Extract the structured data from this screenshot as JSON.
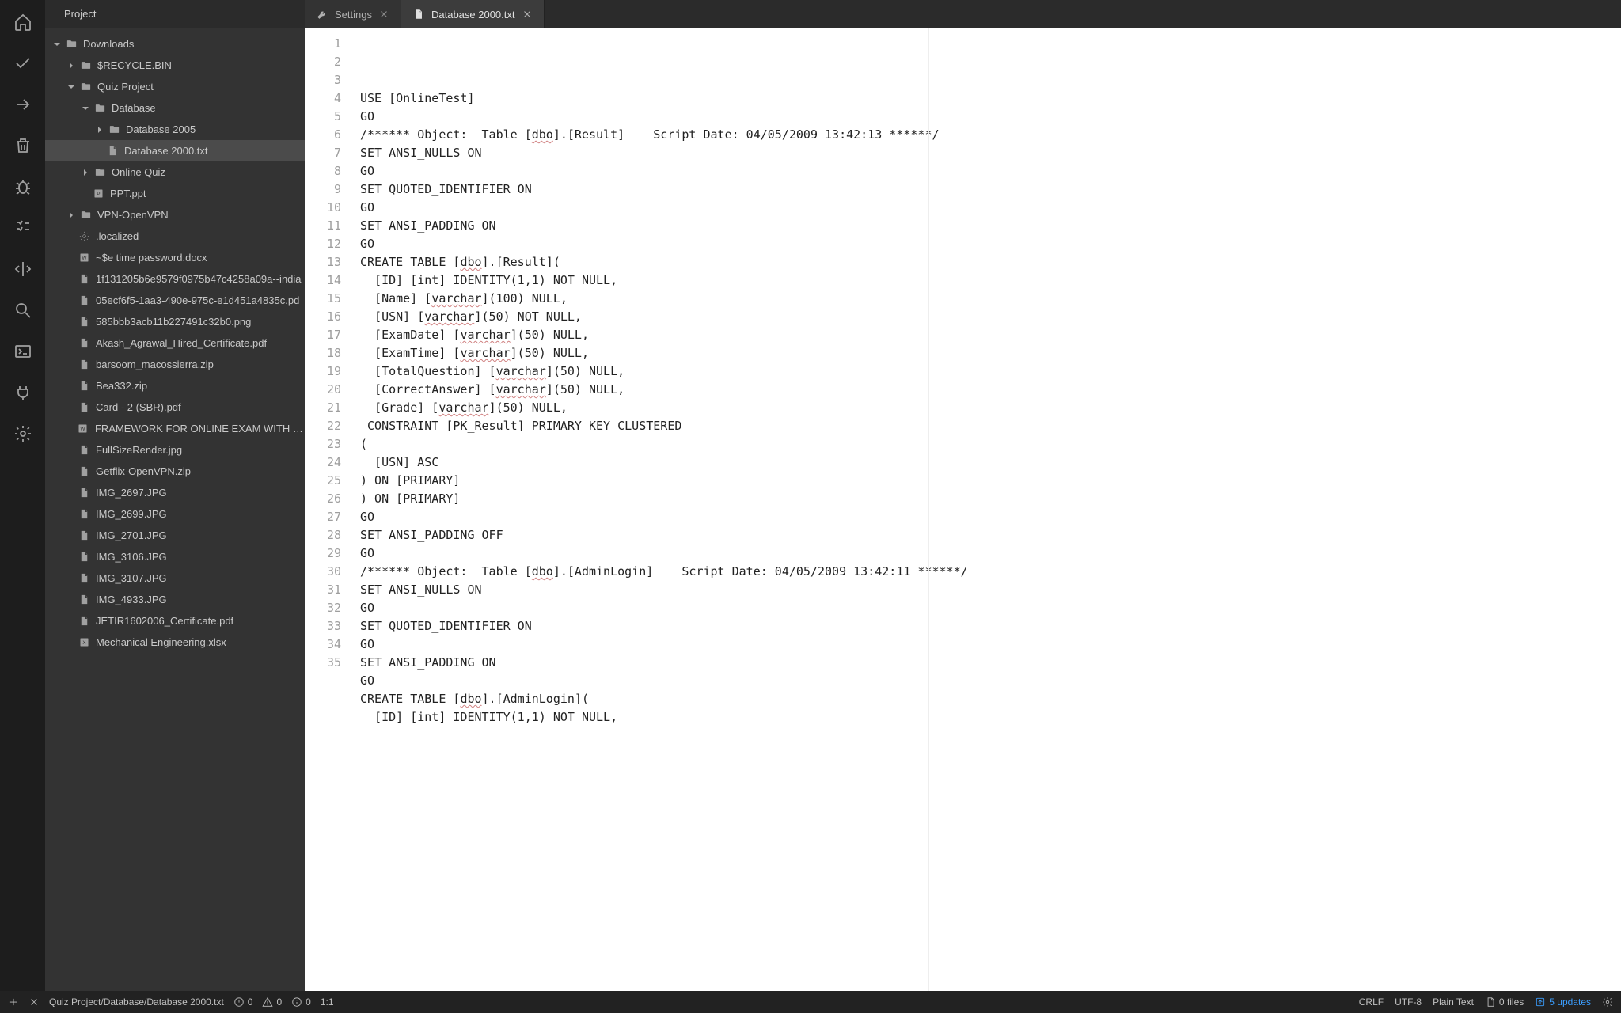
{
  "sidebar": {
    "title": "Project"
  },
  "tree": [
    {
      "depth": 0,
      "arrow": "down",
      "icon": "folder",
      "label": "Downloads"
    },
    {
      "depth": 1,
      "arrow": "right",
      "icon": "folder",
      "label": "$RECYCLE.BIN"
    },
    {
      "depth": 1,
      "arrow": "down",
      "icon": "folder",
      "label": "Quiz Project"
    },
    {
      "depth": 2,
      "arrow": "down",
      "icon": "folder",
      "label": "Database"
    },
    {
      "depth": 3,
      "arrow": "right",
      "icon": "folder",
      "label": "Database 2005"
    },
    {
      "depth": 3,
      "arrow": "none",
      "icon": "file",
      "label": "Database 2000.txt",
      "selected": true
    },
    {
      "depth": 2,
      "arrow": "right",
      "icon": "folder",
      "label": "Online Quiz"
    },
    {
      "depth": 2,
      "arrow": "none",
      "icon": "ppt",
      "label": "PPT.ppt"
    },
    {
      "depth": 1,
      "arrow": "right",
      "icon": "folder",
      "label": "VPN-OpenVPN"
    },
    {
      "depth": 1,
      "arrow": "none",
      "icon": "gear",
      "label": ".localized"
    },
    {
      "depth": 1,
      "arrow": "none",
      "icon": "word",
      "label": "~$e time password.docx"
    },
    {
      "depth": 1,
      "arrow": "none",
      "icon": "pdf",
      "label": "1f131205b6e9579f0975b47c4258a09a--india"
    },
    {
      "depth": 1,
      "arrow": "none",
      "icon": "pdf",
      "label": "05ecf6f5-1aa3-490e-975c-e1d451a4835c.pd"
    },
    {
      "depth": 1,
      "arrow": "none",
      "icon": "pdf",
      "label": "585bbb3acb11b227491c32b0.png"
    },
    {
      "depth": 1,
      "arrow": "none",
      "icon": "pdf",
      "label": "Akash_Agrawal_Hired_Certificate.pdf"
    },
    {
      "depth": 1,
      "arrow": "none",
      "icon": "pdf",
      "label": "barsoom_macossierra.zip"
    },
    {
      "depth": 1,
      "arrow": "none",
      "icon": "pdf",
      "label": "Bea332.zip"
    },
    {
      "depth": 1,
      "arrow": "none",
      "icon": "pdf",
      "label": "Card - 2 (SBR).pdf"
    },
    {
      "depth": 1,
      "arrow": "none",
      "icon": "word",
      "label": "FRAMEWORK FOR ONLINE EXAM WITH GRAP"
    },
    {
      "depth": 1,
      "arrow": "none",
      "icon": "pdf",
      "label": "FullSizeRender.jpg"
    },
    {
      "depth": 1,
      "arrow": "none",
      "icon": "pdf",
      "label": "Getflix-OpenVPN.zip"
    },
    {
      "depth": 1,
      "arrow": "none",
      "icon": "pdf",
      "label": "IMG_2697.JPG"
    },
    {
      "depth": 1,
      "arrow": "none",
      "icon": "pdf",
      "label": "IMG_2699.JPG"
    },
    {
      "depth": 1,
      "arrow": "none",
      "icon": "pdf",
      "label": "IMG_2701.JPG"
    },
    {
      "depth": 1,
      "arrow": "none",
      "icon": "pdf",
      "label": "IMG_3106.JPG"
    },
    {
      "depth": 1,
      "arrow": "none",
      "icon": "pdf",
      "label": "IMG_3107.JPG"
    },
    {
      "depth": 1,
      "arrow": "none",
      "icon": "pdf",
      "label": "IMG_4933.JPG"
    },
    {
      "depth": 1,
      "arrow": "none",
      "icon": "pdf",
      "label": "JETIR1602006_Certificate.pdf"
    },
    {
      "depth": 1,
      "arrow": "none",
      "icon": "excel",
      "label": "Mechanical Engineering.xlsx"
    }
  ],
  "tabs": [
    {
      "icon": "wrench",
      "label": "Settings",
      "active": false
    },
    {
      "icon": "file",
      "label": "Database 2000.txt",
      "active": true
    }
  ],
  "code": {
    "lines": [
      {
        "n": 1,
        "segs": [
          {
            "t": "USE [OnlineTest]"
          }
        ]
      },
      {
        "n": 2,
        "segs": [
          {
            "t": "GO"
          }
        ]
      },
      {
        "n": 3,
        "segs": [
          {
            "t": "/****** Object:  Table ["
          },
          {
            "t": "dbo",
            "w": true
          },
          {
            "t": "].[Result]    Script Date: 04/05/2009 13:42:13 ******/"
          }
        ]
      },
      {
        "n": 4,
        "segs": [
          {
            "t": "SET ANSI_NULLS ON"
          }
        ]
      },
      {
        "n": 5,
        "segs": [
          {
            "t": "GO"
          }
        ]
      },
      {
        "n": 6,
        "segs": [
          {
            "t": "SET QUOTED_IDENTIFIER ON"
          }
        ]
      },
      {
        "n": 7,
        "segs": [
          {
            "t": "GO"
          }
        ]
      },
      {
        "n": 8,
        "segs": [
          {
            "t": "SET ANSI_PADDING ON"
          }
        ]
      },
      {
        "n": 9,
        "segs": [
          {
            "t": "GO"
          }
        ]
      },
      {
        "n": 10,
        "segs": [
          {
            "t": "CREATE TABLE ["
          },
          {
            "t": "dbo",
            "w": true
          },
          {
            "t": "].[Result]("
          }
        ]
      },
      {
        "n": 11,
        "segs": [
          {
            "t": "  [ID] [int] IDENTITY(1,1) NOT NULL,"
          }
        ]
      },
      {
        "n": 12,
        "segs": [
          {
            "t": "  [Name] ["
          },
          {
            "t": "varchar",
            "w": true
          },
          {
            "t": "](100) NULL,"
          }
        ]
      },
      {
        "n": 13,
        "segs": [
          {
            "t": "  [USN] ["
          },
          {
            "t": "varchar",
            "w": true
          },
          {
            "t": "](50) NOT NULL,"
          }
        ]
      },
      {
        "n": 14,
        "segs": [
          {
            "t": "  [ExamDate] ["
          },
          {
            "t": "varchar",
            "w": true
          },
          {
            "t": "](50) NULL,"
          }
        ]
      },
      {
        "n": 15,
        "segs": [
          {
            "t": "  [ExamTime] ["
          },
          {
            "t": "varchar",
            "w": true
          },
          {
            "t": "](50) NULL,"
          }
        ]
      },
      {
        "n": 16,
        "segs": [
          {
            "t": "  [TotalQuestion] ["
          },
          {
            "t": "varchar",
            "w": true
          },
          {
            "t": "](50) NULL,"
          }
        ]
      },
      {
        "n": 17,
        "segs": [
          {
            "t": "  [CorrectAnswer] ["
          },
          {
            "t": "varchar",
            "w": true
          },
          {
            "t": "](50) NULL,"
          }
        ]
      },
      {
        "n": 18,
        "segs": [
          {
            "t": "  [Grade] ["
          },
          {
            "t": "varchar",
            "w": true
          },
          {
            "t": "](50) NULL,"
          }
        ]
      },
      {
        "n": 19,
        "segs": [
          {
            "t": " CONSTRAINT [PK_Result] PRIMARY KEY CLUSTERED "
          }
        ]
      },
      {
        "n": 20,
        "segs": [
          {
            "t": "("
          }
        ]
      },
      {
        "n": 21,
        "segs": [
          {
            "t": "  [USN] ASC"
          }
        ]
      },
      {
        "n": 22,
        "segs": [
          {
            "t": ") ON [PRIMARY]"
          }
        ]
      },
      {
        "n": 23,
        "segs": [
          {
            "t": ") ON [PRIMARY]"
          }
        ]
      },
      {
        "n": 24,
        "segs": [
          {
            "t": "GO"
          }
        ]
      },
      {
        "n": 25,
        "segs": [
          {
            "t": "SET ANSI_PADDING OFF"
          }
        ]
      },
      {
        "n": 26,
        "segs": [
          {
            "t": "GO"
          }
        ]
      },
      {
        "n": 27,
        "segs": [
          {
            "t": "/****** Object:  Table ["
          },
          {
            "t": "dbo",
            "w": true
          },
          {
            "t": "].[AdminLogin]    Script Date: 04/05/2009 13:42:11 ******/"
          }
        ]
      },
      {
        "n": 28,
        "segs": [
          {
            "t": "SET ANSI_NULLS ON"
          }
        ]
      },
      {
        "n": 29,
        "segs": [
          {
            "t": "GO"
          }
        ]
      },
      {
        "n": 30,
        "segs": [
          {
            "t": "SET QUOTED_IDENTIFIER ON"
          }
        ]
      },
      {
        "n": 31,
        "segs": [
          {
            "t": "GO"
          }
        ]
      },
      {
        "n": 32,
        "segs": [
          {
            "t": "SET ANSI_PADDING ON"
          }
        ]
      },
      {
        "n": 33,
        "segs": [
          {
            "t": "GO"
          }
        ]
      },
      {
        "n": 34,
        "segs": [
          {
            "t": "CREATE TABLE ["
          },
          {
            "t": "dbo",
            "w": true
          },
          {
            "t": "].[AdminLogin]("
          }
        ]
      },
      {
        "n": 35,
        "segs": [
          {
            "t": "  [ID] [int] IDENTITY(1,1) NOT NULL,"
          }
        ]
      }
    ]
  },
  "status": {
    "path": "Quiz Project/Database/Database 2000.txt",
    "errors": "0",
    "warnings": "0",
    "info": "0",
    "pos": "1:1",
    "eol": "CRLF",
    "encoding": "UTF-8",
    "files": "0 files",
    "updates": "5 updates",
    "language": "Plain Text"
  }
}
